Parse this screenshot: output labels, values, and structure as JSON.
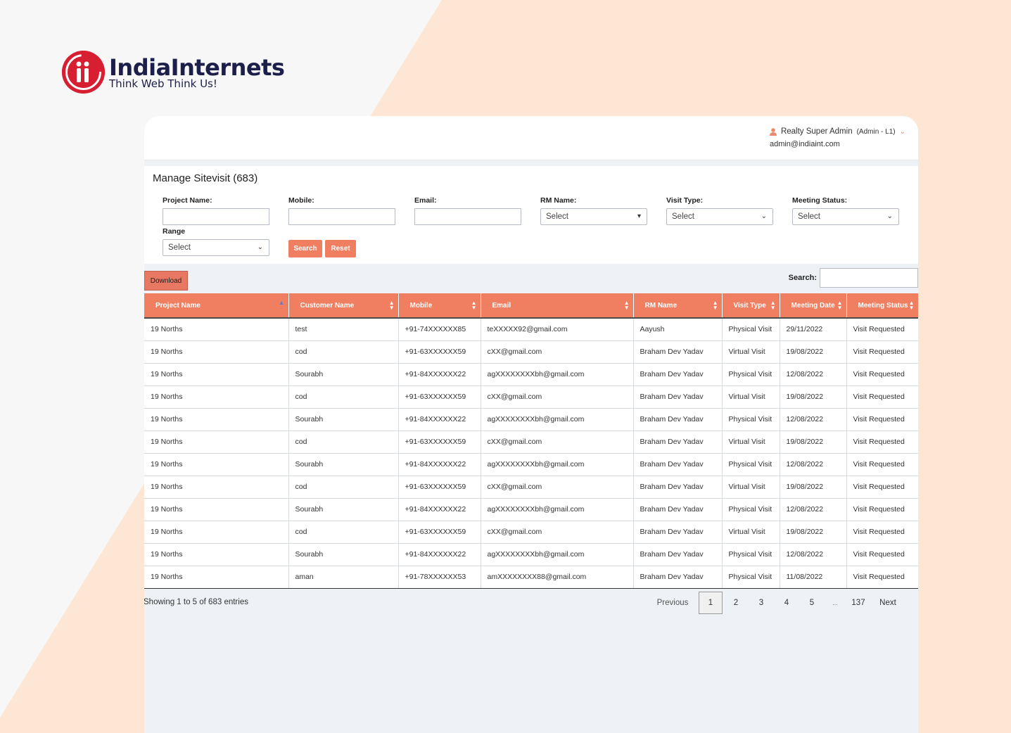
{
  "brand": {
    "name": "IndiaInternets",
    "tagline": "Think Web Think Us!"
  },
  "user": {
    "name": "Realty Super Admin",
    "role": "(Admin - L1)",
    "email": "admin@indiaint.com"
  },
  "page": {
    "title": "Manage Sitevisit (683)"
  },
  "filters": {
    "project_name_label": "Project Name:",
    "mobile_label": "Mobile:",
    "email_label": "Email:",
    "rm_name_label": "RM Name:",
    "rm_name_value": "Select",
    "visit_type_label": "Visit Type:",
    "visit_type_value": "Select",
    "meeting_status_label": "Meeting Status:",
    "meeting_status_value": "Select",
    "range_label": "Range",
    "range_value": "Select",
    "search_button": "Search",
    "reset_button": "Reset"
  },
  "toolbar": {
    "download_label": "Download",
    "search_label": "Search:"
  },
  "table": {
    "columns": [
      "Project Name",
      "Customer Name",
      "Mobile",
      "Email",
      "RM Name",
      "Visit Type",
      "Meeting Date",
      "Meeting Status"
    ],
    "rows": [
      [
        "19 Norths",
        "test",
        "+91-74XXXXXX85",
        "teXXXXX92@gmail.com",
        "Aayush",
        "Physical Visit",
        "29/11/2022",
        "Visit Requested"
      ],
      [
        "19 Norths",
        "cod",
        "+91-63XXXXXX59",
        "cXX@gmail.com",
        "Braham Dev Yadav",
        "Virtual Visit",
        "19/08/2022",
        "Visit Requested"
      ],
      [
        "19 Norths",
        "Sourabh",
        "+91-84XXXXXX22",
        "agXXXXXXXXbh@gmail.com",
        "Braham Dev Yadav",
        "Physical Visit",
        "12/08/2022",
        "Visit Requested"
      ],
      [
        "19 Norths",
        "cod",
        "+91-63XXXXXX59",
        "cXX@gmail.com",
        "Braham Dev Yadav",
        "Virtual Visit",
        "19/08/2022",
        "Visit Requested"
      ],
      [
        "19 Norths",
        "Sourabh",
        "+91-84XXXXXX22",
        "agXXXXXXXXbh@gmail.com",
        "Braham Dev Yadav",
        "Physical Visit",
        "12/08/2022",
        "Visit Requested"
      ],
      [
        "19 Norths",
        "cod",
        "+91-63XXXXXX59",
        "cXX@gmail.com",
        "Braham Dev Yadav",
        "Virtual Visit",
        "19/08/2022",
        "Visit Requested"
      ],
      [
        "19 Norths",
        "Sourabh",
        "+91-84XXXXXX22",
        "agXXXXXXXXbh@gmail.com",
        "Braham Dev Yadav",
        "Physical Visit",
        "12/08/2022",
        "Visit Requested"
      ],
      [
        "19 Norths",
        "cod",
        "+91-63XXXXXX59",
        "cXX@gmail.com",
        "Braham Dev Yadav",
        "Virtual Visit",
        "19/08/2022",
        "Visit Requested"
      ],
      [
        "19 Norths",
        "Sourabh",
        "+91-84XXXXXX22",
        "agXXXXXXXXbh@gmail.com",
        "Braham Dev Yadav",
        "Physical Visit",
        "12/08/2022",
        "Visit Requested"
      ],
      [
        "19 Norths",
        "cod",
        "+91-63XXXXXX59",
        "cXX@gmail.com",
        "Braham Dev Yadav",
        "Virtual Visit",
        "19/08/2022",
        "Visit Requested"
      ],
      [
        "19 Norths",
        "Sourabh",
        "+91-84XXXXXX22",
        "agXXXXXXXXbh@gmail.com",
        "Braham Dev Yadav",
        "Physical Visit",
        "12/08/2022",
        "Visit Requested"
      ],
      [
        "19 Norths",
        "aman",
        "+91-78XXXXXX53",
        "amXXXXXXXX88@gmail.com",
        "Braham Dev Yadav",
        "Physical Visit",
        "11/08/2022",
        "Visit Requested"
      ]
    ]
  },
  "footer": {
    "showing": "Showing 1 to 5 of 683 entries",
    "previous": "Previous",
    "pages": [
      "1",
      "2",
      "3",
      "4",
      "5"
    ],
    "ellipsis": "...",
    "last_page": "137",
    "next": "Next"
  },
  "colors": {
    "accent": "#f07f62",
    "brand_red": "#d71f31",
    "brand_navy": "#1d1f4b",
    "background_peach": "#fde6d2"
  }
}
